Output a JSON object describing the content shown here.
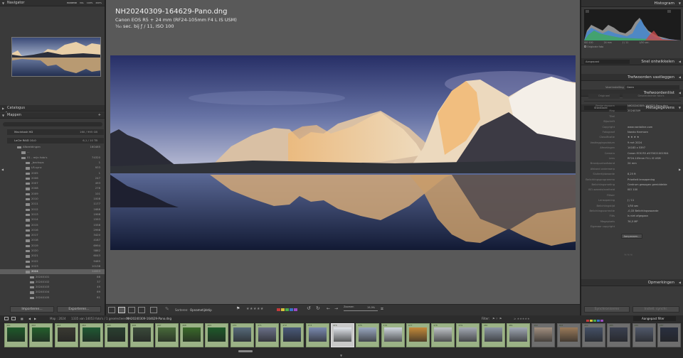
{
  "left_panel": {
    "navigator": {
      "title": "Navigator",
      "zoom_options": [
        "PASSEND",
        "VUL",
        "100%",
        "200%"
      ]
    },
    "catalogus": {
      "title": "Catalogus"
    },
    "mappen": {
      "title": "Mappen"
    },
    "volumes": [
      {
        "name": "Macintosh HD",
        "info": "160 / 995 GB"
      },
      {
        "name": "LaCie RAID 10-0",
        "info": "6,1 / 10 TB"
      }
    ],
    "folders": [
      {
        "name": "Afbeeldingen",
        "count": "160465"
      },
      {
        "name": "...",
        "count": ""
      },
      {
        "name": "01 - mijn foto's",
        "count": "74320"
      },
      {
        "name": "_backups",
        "count": "1"
      },
      {
        "name": "LR-sync",
        "count": "933"
      },
      {
        "name": "2005",
        "count": "1"
      },
      {
        "name": "2006",
        "count": "247"
      },
      {
        "name": "2007",
        "count": "493"
      },
      {
        "name": "2008",
        "count": "276"
      },
      {
        "name": "2009",
        "count": "101"
      },
      {
        "name": "2010",
        "count": "1008"
      },
      {
        "name": "2011",
        "count": "1177"
      },
      {
        "name": "2012",
        "count": "1688"
      },
      {
        "name": "2013",
        "count": "1998"
      },
      {
        "name": "2014",
        "count": "1593"
      },
      {
        "name": "2015",
        "count": "1558"
      },
      {
        "name": "2016",
        "count": "2998"
      },
      {
        "name": "2017",
        "count": "3420"
      },
      {
        "name": "2018",
        "count": "4187"
      },
      {
        "name": "2019",
        "count": "6994"
      },
      {
        "name": "2020",
        "count": "5862"
      },
      {
        "name": "2021",
        "count": "6043"
      },
      {
        "name": "2022",
        "count": "9465"
      },
      {
        "name": "2023",
        "count": "10138"
      },
      {
        "name": "2024",
        "count": "14053"
      },
      {
        "name": "20240101",
        "count": "88"
      },
      {
        "name": "20240102",
        "count": "37"
      },
      {
        "name": "20240103",
        "count": "49"
      },
      {
        "name": "20240104",
        "count": "69"
      },
      {
        "name": "20240105",
        "count": "61"
      }
    ],
    "import_button": "Importeren...",
    "export_button": "Exporteren..."
  },
  "center": {
    "filename": "NH20240309-164629-Pano.dng",
    "camera": "Canon EOS R5 + 24 mm (RF24-105mm F4 L IS USM)",
    "exposure": "⅕₀ sec. bij ƒ / 11, ISO 100"
  },
  "toolbar": {
    "sort_label": "Sorteren:",
    "sort_value": "Opnametijdstip",
    "zoom_label": "Zoomen",
    "zoom_value": "19,9%",
    "flag_colors": [
      "#c33a3a",
      "#d6c23a",
      "#4aa94a",
      "#3a72c9",
      "#9a4ac2"
    ]
  },
  "right_panel": {
    "histogram": {
      "title": "Histogram",
      "info": [
        "ISO 100",
        "24 mm",
        "ƒ / 11",
        "1/50 sec."
      ],
      "original_label": "Originele foto"
    },
    "quick_develop": {
      "preset": "Aangepast",
      "title": "Snel ontwikkelen"
    },
    "keywording": {
      "title": "Trefwoorden vastleggen"
    },
    "keyword_list": {
      "title": "Trefwoordenlijst"
    },
    "metadata": {
      "preset": "Standaard",
      "title": "Metagegevens",
      "preset_label": "Voorinstelling",
      "preset_value": "Geen",
      "tabs": [
        "Origineel",
        "Geselecteerde foto's"
      ],
      "rows": [
        {
          "label": "Bestandsnaam",
          "value": "NH20240309-164629-Pano.dng"
        },
        {
          "label": "Map",
          "value": "20240309"
        },
        {
          "label": "Titel",
          "value": ""
        },
        {
          "label": "Bijschrift",
          "value": ""
        },
        {
          "label": "Copyright",
          "value": "www.nardoline.com"
        },
        {
          "label": "Fotograaf",
          "value": "Nando Harmsen"
        },
        {
          "label": "Classificatie",
          "value": "★ ★ ★ ★"
        },
        {
          "label": "Vastleggingsdatum",
          "value": "9 mrt 2024"
        },
        {
          "label": "Afmetingen",
          "value": "14183 x 5397"
        },
        {
          "label": "Camera",
          "value": "Canon EOS R5 #070021001904"
        },
        {
          "label": "Lens",
          "value": "RF24-105mm F4 L IS USM"
        },
        {
          "label": "Brandpuntsafstand",
          "value": "24 mm"
        },
        {
          "label": "Afstand onderwerp",
          "value": ""
        },
        {
          "label": "Sluitertijdwaarde",
          "value": "8,25 ft"
        },
        {
          "label": "Belichtingsprogramma",
          "value": "Prioriteit lensopening"
        },
        {
          "label": "Belichtingsmeting",
          "value": "Centrum gewogen gemiddelde"
        },
        {
          "label": "ISO-waarde/snelheid",
          "value": "ISO 100"
        },
        {
          "label": "Flitser",
          "value": ""
        },
        {
          "label": "Lensopening",
          "value": "ƒ / 11"
        },
        {
          "label": "Belichtingstijd",
          "value": "1/50 sec"
        },
        {
          "label": "Belichtingscorrectie",
          "value": "-0,33 Belichtingswaarde"
        },
        {
          "label": "Flits",
          "value": "Is niet afgegaan"
        },
        {
          "label": "Megapixels",
          "value": "76,5 MP"
        },
        {
          "label": "Eigenaar copyright",
          "value": ""
        }
      ],
      "customize_button": "Aanpassen..."
    },
    "comments": {
      "title": "Opmerkingen"
    },
    "sync_metadata_button": "Synchroniseren",
    "sync_settings_button": "Instell. synchr."
  },
  "filmstrip": {
    "path": "Map : 2024",
    "count_info": "1335 van 14053 foto's / 1 geselecteerd /",
    "selected_file": "NH20240309-164629-Pano.dng",
    "filter_label": "Filter:",
    "filter_value": "Aangepast filter",
    "numbers": [
      "461",
      "462",
      "463",
      "464",
      "465",
      "466",
      "467",
      "468",
      "469",
      "470",
      "471",
      "472",
      "473",
      "474",
      "475",
      "476",
      "477",
      "478",
      "479",
      "480",
      "481",
      "482",
      "483",
      "484",
      "485",
      "486",
      "487"
    ]
  }
}
